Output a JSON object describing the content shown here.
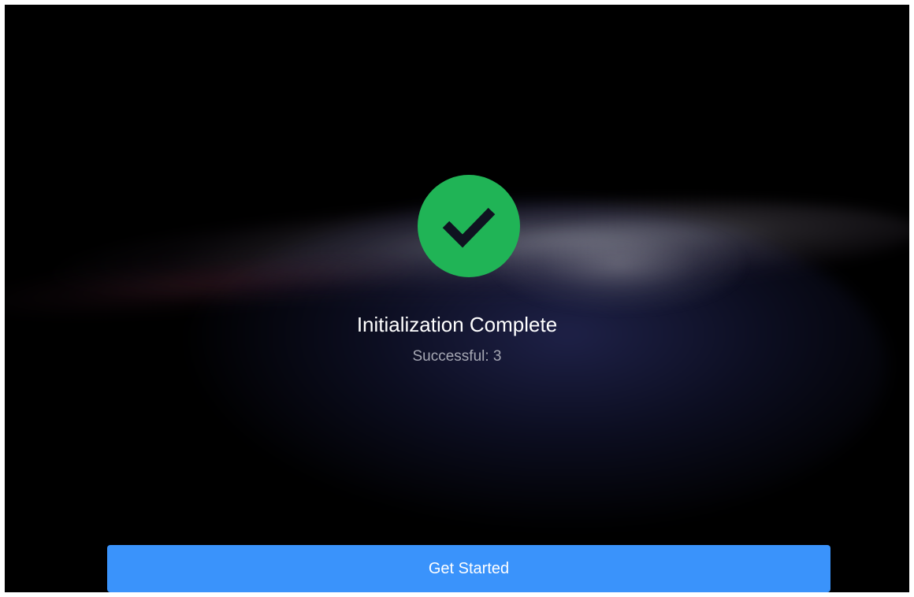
{
  "status": {
    "icon": "checkmark-circle-icon",
    "title": "Initialization Complete",
    "detail": "Successful: 3"
  },
  "actions": {
    "primary_label": "Get Started"
  },
  "colors": {
    "background": "#000000",
    "success": "#20b456",
    "check_stroke": "#0f1220",
    "button": "#3a93fb",
    "title_text": "#ffffff",
    "detail_text": "#a6a8b4"
  }
}
